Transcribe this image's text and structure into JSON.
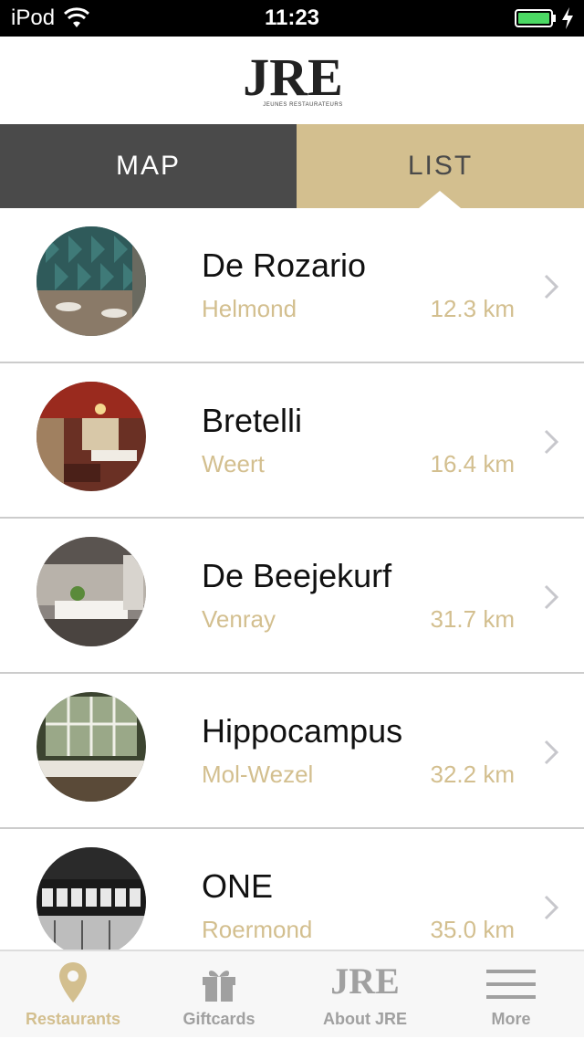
{
  "status_bar": {
    "carrier": "iPod",
    "time": "11:23"
  },
  "header": {
    "logo_text": "JRE",
    "logo_subtitle": "JEUNES RESTAURATEURS"
  },
  "view_tabs": {
    "map": "MAP",
    "list": "LIST",
    "selected": "LIST"
  },
  "restaurants": [
    {
      "name": "De Rozario",
      "city": "Helmond",
      "distance": "12.3 km"
    },
    {
      "name": "Bretelli",
      "city": "Weert",
      "distance": "16.4 km"
    },
    {
      "name": "De Beejekurf",
      "city": "Venray",
      "distance": "31.7 km"
    },
    {
      "name": "Hippocampus",
      "city": "Mol-Wezel",
      "distance": "32.2 km"
    },
    {
      "name": "ONE",
      "city": "Roermond",
      "distance": "35.0 km"
    }
  ],
  "tab_bar": {
    "items": [
      {
        "label": "Restaurants",
        "icon": "map-pin-icon",
        "active": true
      },
      {
        "label": "Giftcards",
        "icon": "gift-icon",
        "active": false
      },
      {
        "label": "About JRE",
        "icon": "jre-logo-icon",
        "active": false
      },
      {
        "label": "More",
        "icon": "hamburger-menu-icon",
        "active": false
      }
    ]
  },
  "colors": {
    "gold": "#d3bf8f",
    "dark_gray": "#4a4a4a",
    "divider": "#cccccc"
  }
}
